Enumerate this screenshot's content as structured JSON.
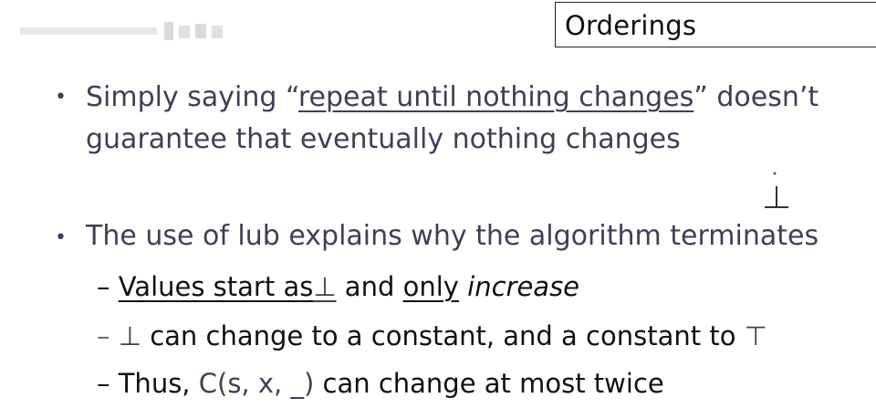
{
  "header": {
    "title": "Orderings"
  },
  "bullets": [
    {
      "line1_pre": "Simply saying “",
      "line1_underlined": "repeat until nothing changes",
      "line1_post": "” doesn’t",
      "line2": "guarantee that eventually nothing changes"
    },
    {
      "text": "The use of lub explains why the algorithm terminates",
      "subitems": [
        {
          "dash": "–",
          "underlined": "Values start as",
          "bottom": "⊥",
          "mid": " and ",
          "underlined2": "only",
          "space": " ",
          "italic": "increase"
        },
        {
          "dash": "–",
          "bottom": "⊥",
          "text": " can change to a constant, and a constant to ",
          "top": "⊤"
        },
        {
          "dash": "–",
          "text1": " Thus, ",
          "func": "C(s, x, _)",
          "text2": " can change at most twice"
        }
      ]
    }
  ],
  "colors": {
    "bullet_text": "#3f3f56",
    "sub_text": "#111111"
  }
}
